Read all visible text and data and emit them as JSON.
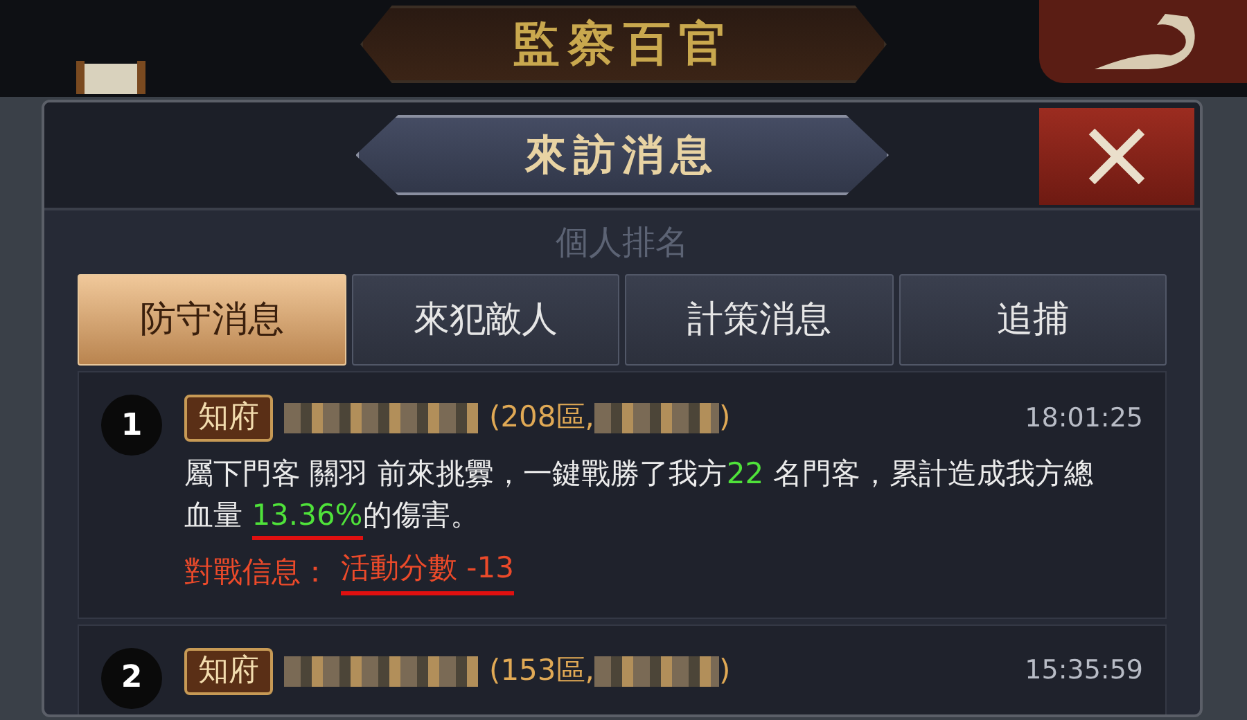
{
  "top_bar": {
    "title": "監察百官"
  },
  "dialog": {
    "title": "來訪消息",
    "ghost_heading": "個人排名"
  },
  "tabs": [
    {
      "label": "防守消息",
      "selected": true
    },
    {
      "label": "來犯敵人",
      "selected": false
    },
    {
      "label": "計策消息",
      "selected": false
    },
    {
      "label": "追捕",
      "selected": false
    }
  ],
  "messages": [
    {
      "rank": "1",
      "title_badge": "知府",
      "server": "(208區,",
      "server_close": ")",
      "time": "18:01:25",
      "body": [
        {
          "kind": "plain",
          "text": "屬下門客 關羽 前來挑釁，一鍵戰勝了我方"
        },
        {
          "kind": "number",
          "text": "22"
        },
        {
          "kind": "plain",
          "text": " 名門客，累計造成我方總血量 "
        },
        {
          "kind": "number",
          "text": "13.36%",
          "underlined": true
        },
        {
          "kind": "plain",
          "text": "的傷害。"
        }
      ],
      "info_label": "對戰信息：",
      "info_value": "活動分數 -13",
      "info_underlined": true
    },
    {
      "rank": "2",
      "title_badge": "知府",
      "server": "(153區,",
      "server_close": ")",
      "time": "15:35:59"
    }
  ]
}
